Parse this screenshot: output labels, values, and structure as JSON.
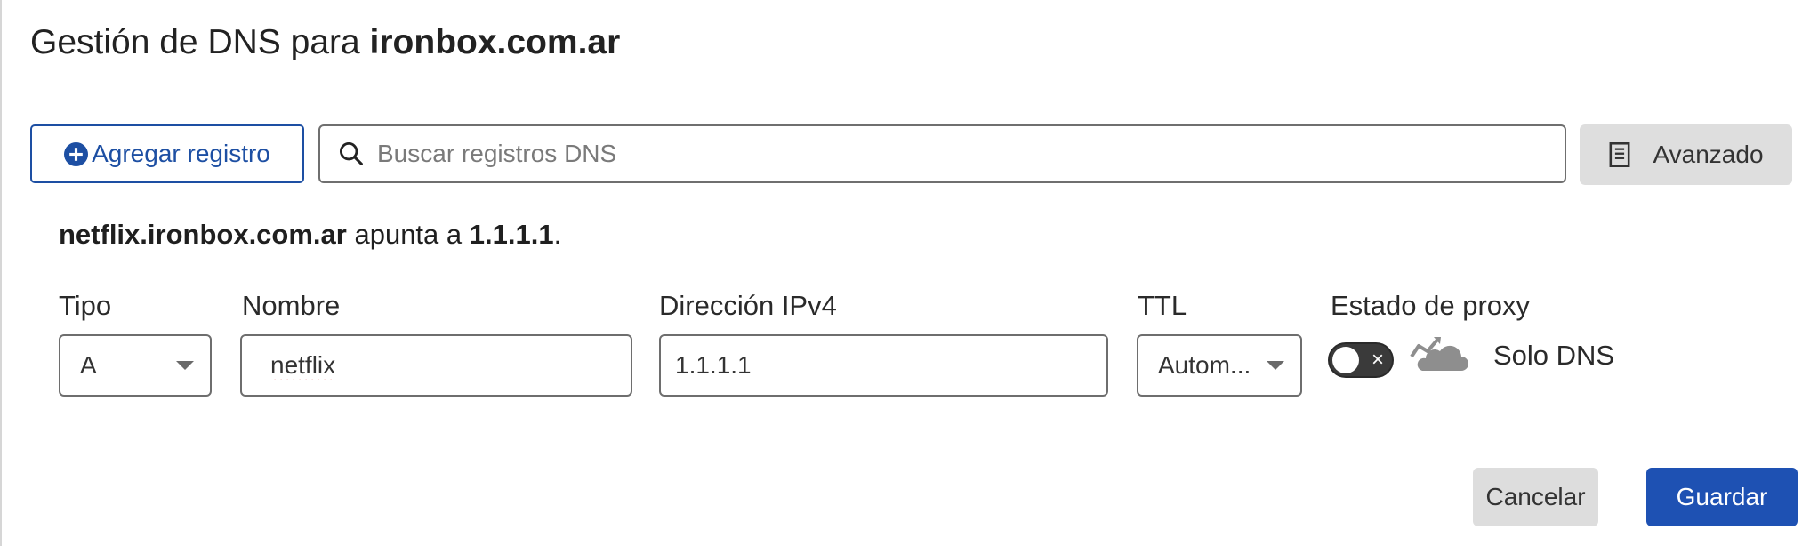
{
  "header": {
    "title_prefix": "Gestión de DNS para",
    "domain": "ironbox.com.ar"
  },
  "toolbar": {
    "add_label": "Agregar registro",
    "search_placeholder": "Buscar registros DNS",
    "search_value": "",
    "advanced_label": "Avanzado"
  },
  "summary": {
    "hostname": "netflix.ironbox.com.ar",
    "verb": "apunta a",
    "target": "1.1.1.1",
    "end": "."
  },
  "form": {
    "type_label": "Tipo",
    "type_value": "A",
    "name_label": "Nombre",
    "name_value": "netflix",
    "ipv4_label": "Dirección IPv4",
    "ipv4_value": "1.1.1.1",
    "ttl_label": "TTL",
    "ttl_value": "Autom...",
    "proxy_label": "Estado de proxy",
    "proxy_status_text": "Solo DNS",
    "proxy_enabled": false
  },
  "actions": {
    "cancel_label": "Cancelar",
    "save_label": "Guardar"
  },
  "icons": [
    "plus-circle-icon",
    "search-icon",
    "document-icon",
    "chevron-down-icon",
    "toggle-x-icon",
    "cloud-dns-only-icon"
  ],
  "colors": {
    "accent": "#1d4fa3",
    "save_button": "#1e51b3",
    "neutral_button": "#dddddd",
    "toggle_off": "#3a3a3a"
  }
}
